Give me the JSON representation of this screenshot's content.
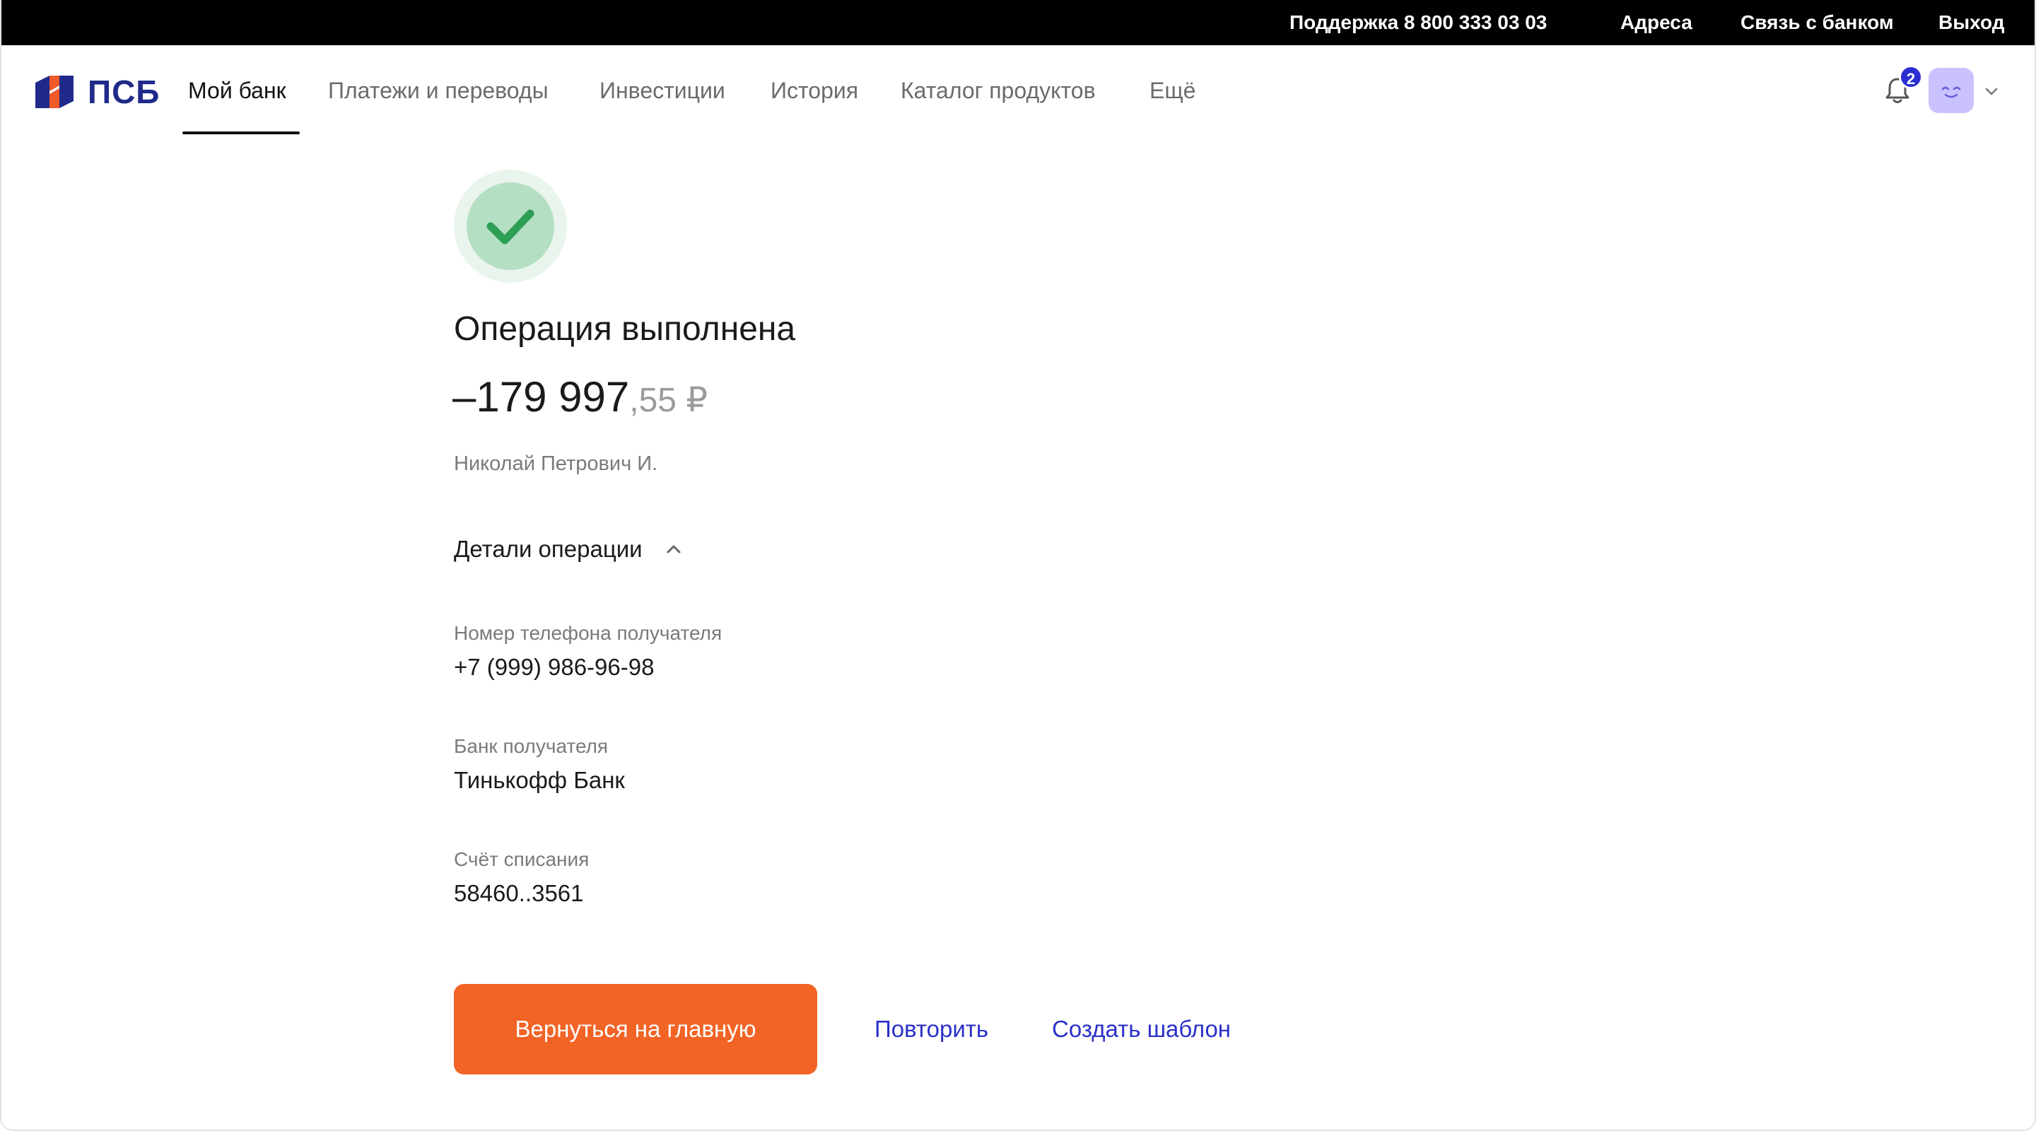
{
  "topbar": {
    "support": "Поддержка 8 800 333 03 03",
    "addresses": "Адреса",
    "contact": "Связь с банком",
    "logout": "Выход"
  },
  "header": {
    "logo_text": "ПСБ",
    "nav": [
      {
        "label": "Мой банк",
        "active": true
      },
      {
        "label": "Платежи и переводы"
      },
      {
        "label": "Инвестиции"
      },
      {
        "label": "История"
      },
      {
        "label": "Каталог продуктов"
      },
      {
        "label": "Ещё"
      }
    ],
    "notifications_count": "2"
  },
  "operation": {
    "status_title": "Операция выполнена",
    "amount_main": "–179 997",
    "amount_fraction": ",55 ₽",
    "recipient_name": "Николай Петрович И.",
    "details_toggle": "Детали операции",
    "fields": [
      {
        "label": "Номер телефона получателя",
        "value": "+7 (999) 986-96-98"
      },
      {
        "label": "Банк получателя",
        "value": "Тинькофф Банк"
      },
      {
        "label": "Счёт списания",
        "value": "58460..3561"
      }
    ]
  },
  "actions": {
    "home": "Вернуться на главную",
    "repeat": "Повторить",
    "template": "Создать шаблон"
  },
  "colors": {
    "accent_orange": "#f26426",
    "link_blue": "#2b2fc9",
    "success_green": "#2e9e57",
    "brand_navy": "#1f2a8a",
    "brand_orange": "#f0592a"
  }
}
